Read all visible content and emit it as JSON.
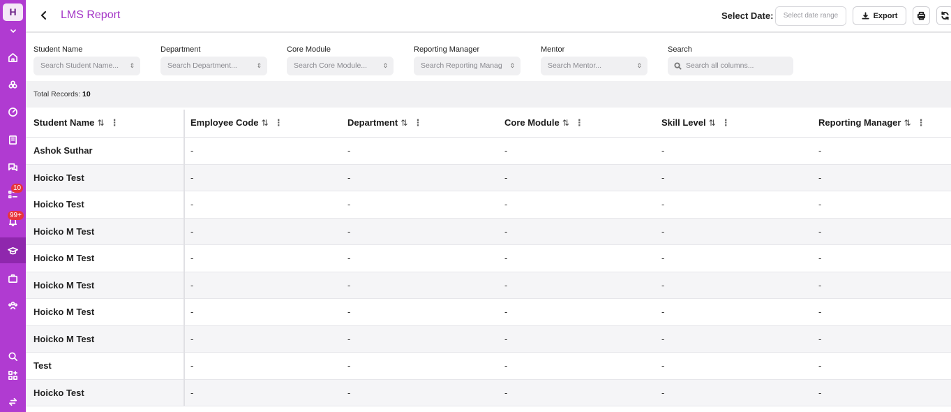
{
  "sidebar": {
    "brand_letter": "H",
    "badges": {
      "tasks": "10",
      "notifications": "99+"
    },
    "icons": [
      "home-icon",
      "grid-icon",
      "dashboard-icon",
      "book-icon",
      "chat-icon",
      "tasks-icon",
      "bell-icon",
      "graduation-cap-icon",
      "briefcase-icon",
      "team-icon",
      "search-icon",
      "apps-icon",
      "switch-icon"
    ],
    "bg_color": "#b03bd1",
    "active_color": "#8f27ad"
  },
  "header": {
    "title": "LMS Report",
    "date_label": "Select Date:",
    "date_placeholder": "Select date range",
    "export_label": "Export"
  },
  "filters": {
    "student_name": {
      "label": "Student Name",
      "placeholder": "Search Student Name..."
    },
    "department": {
      "label": "Department",
      "placeholder": "Search Department..."
    },
    "core_module": {
      "label": "Core Module",
      "placeholder": "Search Core Module..."
    },
    "reporting_manager": {
      "label": "Reporting Manager",
      "placeholder": "Search Reporting Manag"
    },
    "mentor": {
      "label": "Mentor",
      "placeholder": "Search Mentor..."
    },
    "search": {
      "label": "Search",
      "placeholder": "Search all columns..."
    }
  },
  "records": {
    "label": "Total Records:",
    "count": "10"
  },
  "table": {
    "columns": [
      "Student Name",
      "Employee Code",
      "Department",
      "Core Module",
      "Skill Level",
      "Reporting Manager"
    ],
    "rows": [
      [
        "Ashok Suthar",
        "-",
        "-",
        "-",
        "-",
        "-"
      ],
      [
        "Hoicko Test",
        "-",
        "-",
        "-",
        "-",
        "-"
      ],
      [
        "Hoicko Test",
        "-",
        "-",
        "-",
        "-",
        "-"
      ],
      [
        "Hoicko M Test",
        "-",
        "-",
        "-",
        "-",
        "-"
      ],
      [
        "Hoicko M Test",
        "-",
        "-",
        "-",
        "-",
        "-"
      ],
      [
        "Hoicko M Test",
        "-",
        "-",
        "-",
        "-",
        "-"
      ],
      [
        "Hoicko M Test",
        "-",
        "-",
        "-",
        "-",
        "-"
      ],
      [
        "Hoicko M Test",
        "-",
        "-",
        "-",
        "-",
        "-"
      ],
      [
        "Test",
        "-",
        "-",
        "-",
        "-",
        "-"
      ],
      [
        "Hoicko Test",
        "-",
        "-",
        "-",
        "-",
        "-"
      ]
    ]
  },
  "colors": {
    "accent": "#a334c6"
  }
}
